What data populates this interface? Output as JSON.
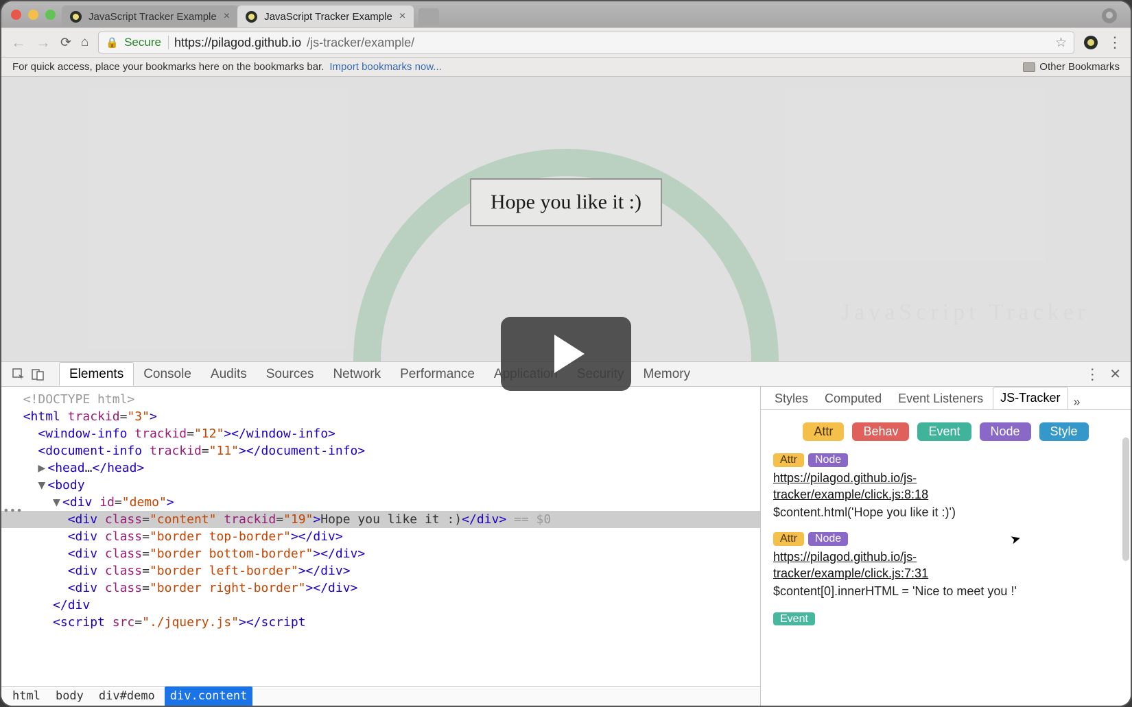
{
  "window": {
    "tabs": [
      {
        "title": "JavaScript Tracker Example",
        "active": false
      },
      {
        "title": "JavaScript Tracker Example",
        "active": true
      }
    ]
  },
  "urlbar": {
    "secure_label": "Secure",
    "url_scheme_host": "https://pilagod.github.io",
    "url_path": "/js-tracker/example/"
  },
  "bookmarks_hint": {
    "text": "For quick access, place your bookmarks here on the bookmarks bar.",
    "import_link": "Import bookmarks now...",
    "other_label": "Other Bookmarks"
  },
  "page": {
    "box_text": "Hope you like it :)",
    "watermark": "JavaScript Tracker"
  },
  "devtools": {
    "tabs": [
      "Elements",
      "Console",
      "Audits",
      "Sources",
      "Network",
      "Performance",
      "Application",
      "Security",
      "Memory"
    ],
    "active_tab": "Elements",
    "dom_lines": [
      {
        "indent": 1,
        "raw": "<!DOCTYPE html>",
        "kind": "doctype"
      },
      {
        "indent": 1,
        "raw_open": "<html ",
        "attrs": [
          [
            "trackid",
            "3"
          ]
        ],
        "raw_close": ">"
      },
      {
        "indent": 2,
        "raw_open": "<window-info ",
        "attrs": [
          [
            "trackid",
            "12"
          ]
        ],
        "raw_close": "></window-info>"
      },
      {
        "indent": 2,
        "raw_open": "<document-info ",
        "attrs": [
          [
            "trackid",
            "11"
          ]
        ],
        "raw_close": "></document-info>"
      },
      {
        "indent": 2,
        "twisty": "▶",
        "raw_open": "<head>",
        "ellipsis": "…",
        "raw_close": "</head>"
      },
      {
        "indent": 2,
        "twisty": "▼",
        "raw_open": "<body>"
      },
      {
        "indent": 3,
        "twisty": "▼",
        "raw_open": "<div ",
        "attrs": [
          [
            "id",
            "demo"
          ]
        ],
        "raw_close": ">"
      },
      {
        "indent": 4,
        "selected": true,
        "raw_open": "<div ",
        "attrs": [
          [
            "class",
            "content"
          ],
          [
            "trackid",
            "19"
          ]
        ],
        "raw_mid": ">",
        "text": "Hope you like it :)",
        "raw_close": "</div>",
        "suffix": " == $0"
      },
      {
        "indent": 4,
        "raw_open": "<div ",
        "attrs": [
          [
            "class",
            "border top-border"
          ]
        ],
        "raw_close": "></div>"
      },
      {
        "indent": 4,
        "raw_open": "<div ",
        "attrs": [
          [
            "class",
            "border bottom-border"
          ]
        ],
        "raw_close": "></div>"
      },
      {
        "indent": 4,
        "raw_open": "<div ",
        "attrs": [
          [
            "class",
            "border left-border"
          ]
        ],
        "raw_close": "></div>"
      },
      {
        "indent": 4,
        "raw_open": "<div ",
        "attrs": [
          [
            "class",
            "border right-border"
          ]
        ],
        "raw_close": "></div>"
      },
      {
        "indent": 3,
        "raw_open": "</div>"
      },
      {
        "indent": 3,
        "raw_open": "<script ",
        "attrs": [
          [
            "src",
            "./jquery.js"
          ]
        ],
        "raw_close": "></script",
        "cutoff": true
      }
    ],
    "breadcrumb": [
      "html",
      "body",
      "div#demo",
      "div.content"
    ],
    "breadcrumb_selected": 3,
    "side_tabs": [
      "Styles",
      "Computed",
      "Event Listeners",
      "JS-Tracker"
    ],
    "side_active": "JS-Tracker",
    "filters": [
      {
        "label": "Attr",
        "cls": "b-attr"
      },
      {
        "label": "Behav",
        "cls": "b-behav"
      },
      {
        "label": "Event",
        "cls": "b-event"
      },
      {
        "label": "Node",
        "cls": "b-node"
      },
      {
        "label": "Style",
        "cls": "b-style"
      }
    ],
    "entries": [
      {
        "tags": [
          {
            "label": "Attr",
            "cls": "b-attr"
          },
          {
            "label": "Node",
            "cls": "b-node"
          }
        ],
        "link_lines": [
          "https://pilagod.github.io/js-",
          "tracker/example/click.js:8:18"
        ],
        "code": "$content.html('Hope you like it :)')"
      },
      {
        "tags": [
          {
            "label": "Attr",
            "cls": "b-attr"
          },
          {
            "label": "Node",
            "cls": "b-node"
          }
        ],
        "link_lines": [
          "https://pilagod.github.io/js-",
          "tracker/example/click.js:7:31"
        ],
        "code": "$content[0].innerHTML = 'Nice to meet you !'"
      }
    ],
    "half_entry_tag": {
      "label": "Event",
      "cls": "b-event"
    }
  }
}
